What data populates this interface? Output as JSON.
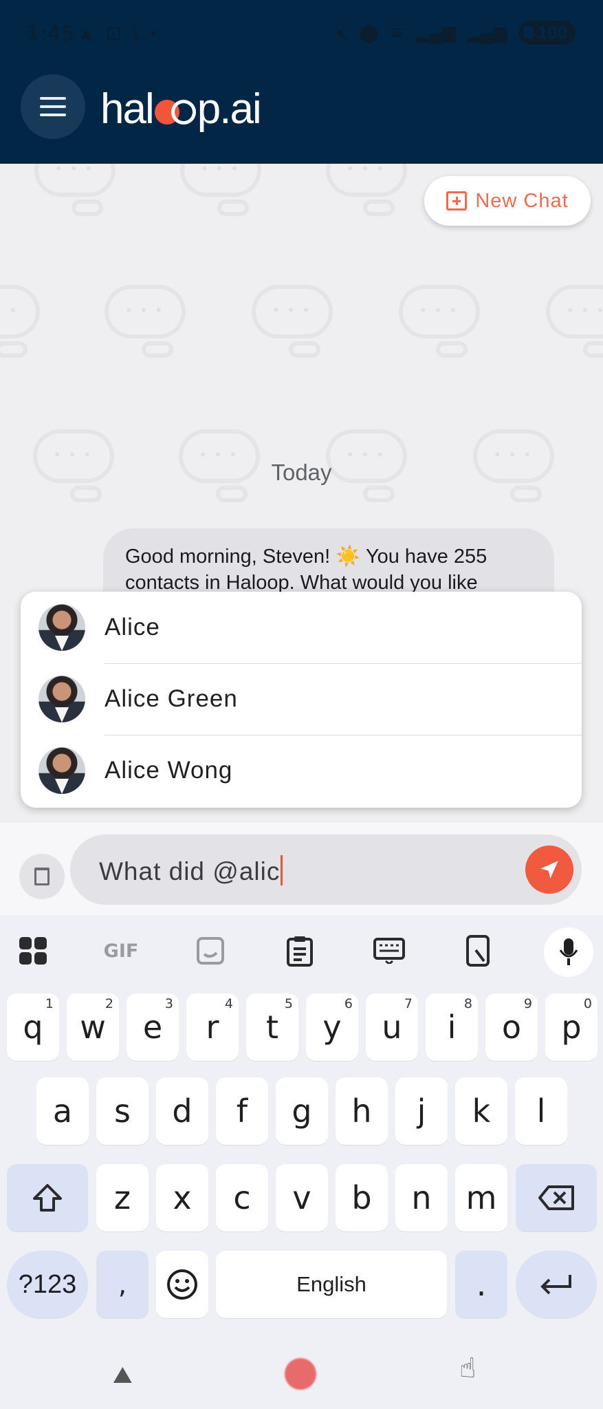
{
  "status_bar": {
    "time": "1:45",
    "battery": "100",
    "left_icons": [
      "warning-icon",
      "screenshot-icon",
      "download-icon",
      "dot-icon"
    ],
    "right_icons": [
      "mute-icon",
      "location-icon",
      "wifi-icon",
      "signal-icon",
      "signal-icon"
    ]
  },
  "header": {
    "app_name": "haloop.ai",
    "logo_prefix": "hal",
    "logo_suffix": "p.ai",
    "brand_color": "#022746",
    "accent_color": "#f15a3e"
  },
  "chat": {
    "new_chat_label": "New Chat",
    "date_divider": "Today",
    "messages": [
      {
        "sender": "assistant",
        "text_before": "Good morning, Steven! ",
        "emoji": "☀️",
        "text_after": " You have 255 contacts in Haloop. What would you like"
      }
    ]
  },
  "mentions": [
    {
      "name": "Alice"
    },
    {
      "name": "Alice Green"
    },
    {
      "name": "Alice Wong"
    }
  ],
  "compose": {
    "value": "What did @alic"
  },
  "keyboard": {
    "toolbar": [
      "apps-icon",
      "GIF",
      "sticker-icon",
      "clipboard-icon",
      "keyboard-icon",
      "phone-icon",
      "mic-icon"
    ],
    "gif_label": "GIF",
    "row1": [
      {
        "k": "q",
        "s": "1"
      },
      {
        "k": "w",
        "s": "2"
      },
      {
        "k": "e",
        "s": "3"
      },
      {
        "k": "r",
        "s": "4"
      },
      {
        "k": "t",
        "s": "5"
      },
      {
        "k": "y",
        "s": "6"
      },
      {
        "k": "u",
        "s": "7"
      },
      {
        "k": "i",
        "s": "8"
      },
      {
        "k": "o",
        "s": "9"
      },
      {
        "k": "p",
        "s": "0"
      }
    ],
    "row2": [
      "a",
      "s",
      "d",
      "f",
      "g",
      "h",
      "j",
      "k",
      "l"
    ],
    "row3": [
      "z",
      "x",
      "c",
      "v",
      "b",
      "n",
      "m"
    ],
    "symbols_label": "?123",
    "comma_label": ",",
    "space_label": "English",
    "period_label": "."
  }
}
